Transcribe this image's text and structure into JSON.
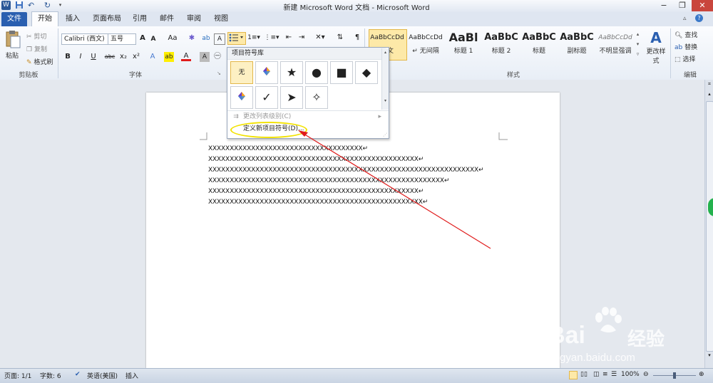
{
  "window": {
    "title": "新建 Microsoft Word 文档 - Microsoft Word",
    "controls": {
      "minimize": "−",
      "restore": "❐",
      "close": "✕"
    }
  },
  "quick_access": {
    "app_icon": "W",
    "save_icon": "floppy-icon",
    "undo": "↶",
    "redo": "↻"
  },
  "tabs": [
    "文件",
    "开始",
    "插入",
    "页面布局",
    "引用",
    "邮件",
    "审阅",
    "视图"
  ],
  "ribbon": {
    "clipboard": {
      "paste": "粘贴",
      "cut": "剪切",
      "copy": "复制",
      "format_painter": "格式刷",
      "label": "剪贴板"
    },
    "font": {
      "font_name": "Calibri (西文)",
      "font_size": "五号",
      "grow": "A",
      "shrink": "A",
      "case": "Aa",
      "bold": "B",
      "italic": "I",
      "underline": "U",
      "strike": "abc",
      "subscript": "x₂",
      "superscript": "x²",
      "label": "字体"
    },
    "paragraph": {
      "label": "段落"
    },
    "styles": {
      "items": [
        {
          "sample": "AaBbCcDd",
          "name": "正文"
        },
        {
          "sample": "AaBbCcDd",
          "name": "↵ 无间隔"
        },
        {
          "sample": "AaBl",
          "name": "标题 1"
        },
        {
          "sample": "AaBbC",
          "name": "标题 2"
        },
        {
          "sample": "AaBbC",
          "name": "标题"
        },
        {
          "sample": "AaBbC",
          "name": "副标题"
        },
        {
          "sample": "AaBbCcDd",
          "name": "不明显强调"
        }
      ],
      "change_styles": "更改样式",
      "label": "样式"
    },
    "editing": {
      "find": "查找",
      "replace": "替换",
      "select": "选择",
      "label": "编辑"
    }
  },
  "bullet_menu": {
    "header": "项目符号库",
    "none_label": "无",
    "row1": [
      "无",
      "◆",
      "★",
      "●",
      "■",
      "◆"
    ],
    "row2": [
      "◆",
      "✓",
      "➤",
      "✧"
    ],
    "change_level": "更改列表级别(C)",
    "define_new": "定义新项目符号(D)..."
  },
  "document": {
    "lines": [
      "XXXXXXXXXXXXXXXXXXXXXXXXXXXXXXXXXXXX↵",
      "XXXXXXXXXXXXXXXXXXXXXXXXXXXXXXXXXXXXXXXXXXXXXXXXX↵",
      "XXXXXXXXXXXXXXXXXXXXXXXXXXXXXXXXXXXXXXXXXXXXXXXXXXXXXXXXXXXXXXX↵",
      "XXXXXXXXXXXXXXXXXXXXXXXXXXXXXXXXXXXXXXXXXXXXXXXXXXXXXXX↵",
      "XXXXXXXXXXXXXXXXXXXXXXXXXXXXXXXXXXXXXXXXXXXXXXXXX↵",
      "XXXXXXXXXXXXXXXXXXXXXXXXXXXXXXXXXXXXXXXXXXXXXXXXXX↵"
    ]
  },
  "statusbar": {
    "page": "页面: 1/1",
    "words": "字数: 6",
    "language": "英语(美国)",
    "mode": "插入",
    "zoom": "100%"
  },
  "watermark": {
    "brand": "Bai",
    "brand2": "经验",
    "url": "jingyan.baidu.com"
  },
  "colors": {
    "file_tab": "#2a5fb0",
    "annotation": "#e01b1b",
    "highlight_ring": "#f2e200"
  }
}
